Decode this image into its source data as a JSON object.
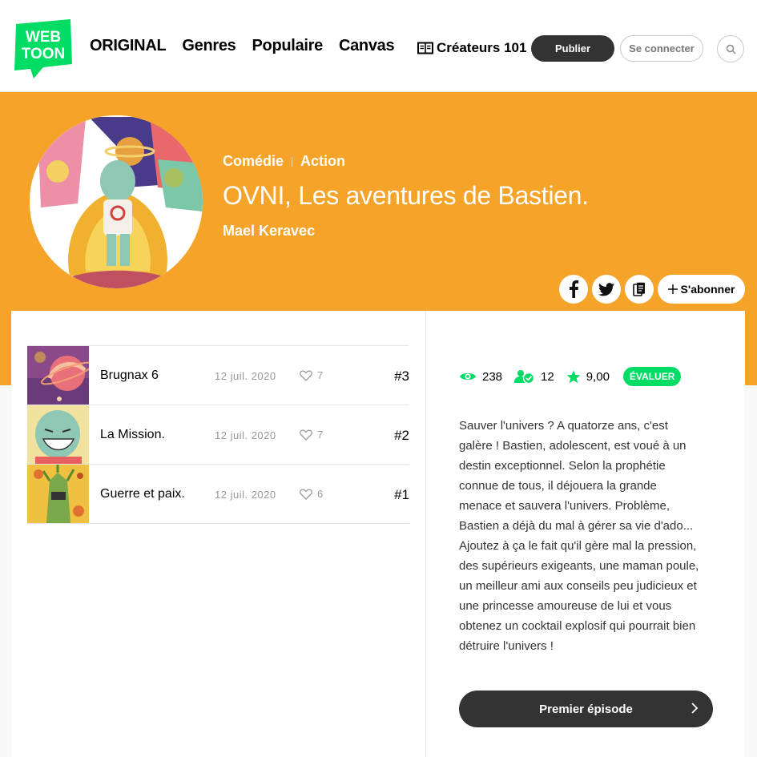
{
  "header": {
    "logo_top": "WEB",
    "logo_bottom": "TOON",
    "nav": [
      "ORIGINAL",
      "Genres",
      "Populaire",
      "Canvas"
    ],
    "creators_label": "Créateurs 101",
    "publish_label": "Publier",
    "login_label": "Se connecter",
    "search_icon": "search-icon"
  },
  "series": {
    "genres": [
      "Comédie",
      "Action"
    ],
    "title": "OVNI, Les aventures de Bastien.",
    "author": "Mael Keravec",
    "subscribe_label": "S'abonner",
    "banner_color": "#f6a32a"
  },
  "episodes": [
    {
      "title": "Brugnax 6",
      "date": "12 juil. 2020",
      "likes": "7",
      "number": "#3"
    },
    {
      "title": "La Mission.",
      "date": "12 juil. 2020",
      "likes": "7",
      "number": "#2"
    },
    {
      "title": "Guerre et paix.",
      "date": "12 juil. 2020",
      "likes": "6",
      "number": "#1"
    }
  ],
  "stats": {
    "views": "238",
    "subscribers": "12",
    "rating": "9,00",
    "rate_label": "ÉVALUER",
    "accent": "#00dc64"
  },
  "summary": "Sauver l'univers ? A quatorze ans, c'est galère ! Bastien, adolescent, est voué à un destin exceptionnel. Selon la prophétie connue de tous, il déjouera la grande menace et sauvera l'univers. Problème, Bastien a déjà du mal à gérer sa vie d'ado... Ajoutez à ça le fait qu'il gère mal la pression, des supérieurs exigeants, une maman poule, un meilleur ami aux conseils peu judicieux et une princesse amoureuse de lui et vous obtenez un cocktail explosif qui pourrait bien détruire l'univers !",
  "first_episode_label": "Premier épisode"
}
